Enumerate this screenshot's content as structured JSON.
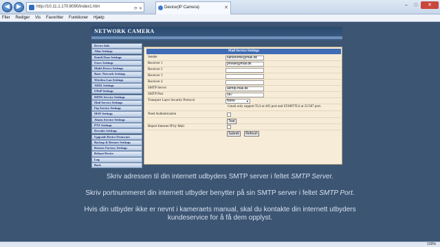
{
  "browser": {
    "address": "http://10.11.1.170:8090/index1.htm",
    "tab_title": "Device(IP Camera)",
    "zoom": "100%"
  },
  "menu": [
    "Filer",
    "Rediger",
    "Vis",
    "Favoritter",
    "Funktioner",
    "Hjælp"
  ],
  "camera": {
    "header": "NETWORK CAMERA",
    "sidebar": [
      "Device Info",
      "Alias Settings",
      "Date&Time Settings",
      "Users Settings",
      "Multi-Device Settings",
      "Basic Network Settings",
      "Wireless Lan Settings",
      "ADSL Settings",
      "UPnP Settings",
      "DDNS Service Settings",
      "Mail Service Settings",
      "Ftp Service Settings",
      "MSN Settings",
      "Alarm Service Settings",
      "PTZ Settings",
      "Decoder Settings",
      "Upgrade Device Firmware",
      "Backup & Restore Settings",
      "Restore Factory Settings",
      "Reboot Device",
      "Log",
      "Back"
    ],
    "panel": {
      "title": "Mail Service Settings",
      "fields": [
        {
          "label": "Sender",
          "value": "sahshome@mail.dk"
        },
        {
          "label": "Receiver 1",
          "value": "privale@mail.dk"
        },
        {
          "label": "Receiver 2",
          "value": ""
        },
        {
          "label": "Receiver 3",
          "value": ""
        },
        {
          "label": "Receiver 4",
          "value": ""
        },
        {
          "label": "SMTP Server",
          "value": "asmtp.mail.dk"
        },
        {
          "label": "SMTP Port",
          "value": "587"
        }
      ],
      "tls_label": "Transport Layer Security Protocol",
      "tls_value": "None",
      "gmail_note": "Gmail only support TLS at 465 port and STARTTLS at 25/587 port.",
      "auth_label": "Need Authentication",
      "test_label": "Test",
      "report_label": "Report Internet IP by Mail",
      "submit_label": "Submit",
      "refresh_label": "Refresh"
    }
  },
  "subtitles": {
    "line1_prefix": "Skriv adressen til din internett udbyders SMTP server i feltet ",
    "line1_em": "SMTP Server.",
    "line2_prefix": "Skriv portnummeret din internett utbyder benytter på sin SMTP server i feltet ",
    "line2_em": "SMTP Port.",
    "line3a": "Hvis din utbyder ikke er nevnt i kameraets manual, skal du kontakte din internett utbyders",
    "line3b": "kundeservice for å få dem opplyst."
  }
}
